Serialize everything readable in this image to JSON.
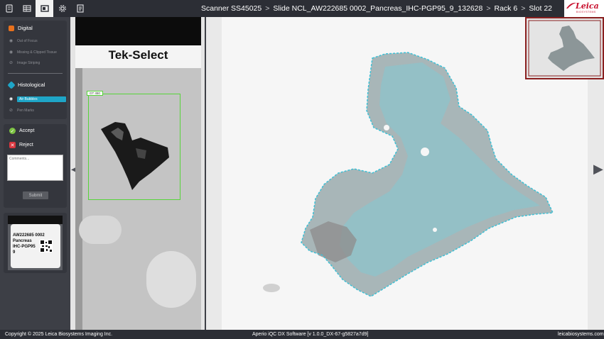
{
  "breadcrumb": {
    "scanner": "Scanner SS45025",
    "slide": "Slide NCL_AW222685 0002_Pancreas_IHC-PGP95_9_132628",
    "rack": "Rack 6",
    "slot": "Slot 22",
    "separator": ">"
  },
  "logo": {
    "text": "Leica",
    "sub": "BIOSYSTEMS"
  },
  "toolbar": {
    "icons": [
      "scanner-icon",
      "grid-icon",
      "slide-view-icon",
      "settings-icon",
      "report-icon"
    ],
    "active_index": 2
  },
  "filters": {
    "digital": {
      "title": "Digital",
      "items": [
        "Out of Focus",
        "Missing & Clipped Tissue",
        "Image Striping"
      ]
    },
    "histological": {
      "title": "Histological",
      "items": [
        "Air Bubbles",
        "Pen Marks"
      ],
      "selected": "Air Bubbles"
    }
  },
  "review": {
    "accept": "Accept",
    "reject": "Reject",
    "comments_placeholder": "Comments...",
    "submit": "Submit"
  },
  "slide_label": {
    "line1": "AW222685 0002",
    "line2": "Pancreas",
    "line3": "IHC-PGP95",
    "line4": "9"
  },
  "strip": {
    "brand": "Tek-Select",
    "roi_tag": "GT 450"
  },
  "footer": {
    "copyright": "Copyright © 2025 Leica Biosystems Imaging Inc.",
    "software": "Aperio iQC DX Software [v 1.0.0_DX-67-g5827a7d9]",
    "website": "leicabiosystems.com"
  },
  "colors": {
    "accent": "#1ea5c7",
    "accept": "#7cc242",
    "reject": "#d9363e",
    "roi_box": "#57d43a",
    "digital_icon": "#e8711d",
    "overlay": "#3cc1d6"
  }
}
